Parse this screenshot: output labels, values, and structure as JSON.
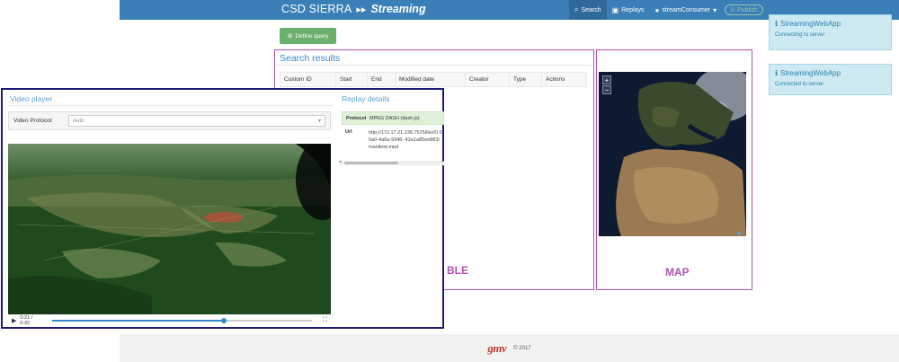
{
  "navbar": {
    "brand": "CSD SIERRA",
    "brand_sub": "Streaming",
    "search": "Search",
    "replays": "Replays",
    "user": "streamConsumer",
    "publish": "Publish"
  },
  "main": {
    "define_query": "Define query",
    "search_results_title": "Search results",
    "columns": [
      "Custom ID",
      "Start",
      "End",
      "Modified date",
      "Creator",
      "Type",
      "Actions"
    ],
    "table_overlay_label": "BLE",
    "map_overlay_label": "MAP",
    "map_zoom_in": "+",
    "map_zoom_out": "−"
  },
  "toasts": [
    {
      "title": "StreamingWebApp",
      "message": "Connecting to server"
    },
    {
      "title": "StreamingWebApp",
      "message": "Connected to server"
    }
  ],
  "video_panel": {
    "title": "Video player",
    "protocol_label": "Video Protocol:",
    "protocol_value": "Auto",
    "time": "0:21 / 0:32",
    "progress": 0.66
  },
  "replay_details": {
    "title": "Replay details",
    "header_key": "Protocol",
    "header_value": "MPEG DASH (dash.js)",
    "url_key": "Url",
    "url_value": "http://172.17.21.235:7575/live/0 00a0-4a0a-9346- 42a1a85ee883/manifest.mpd"
  },
  "footer": {
    "logo": "gmv",
    "copyright": "© 2017"
  },
  "colors": {
    "navbar": "#3a7fb8",
    "accent": "#3a87c7",
    "overlay_border": "#b34fb3",
    "video_border": "#1b1b7a",
    "button_green": "#6db06d"
  }
}
